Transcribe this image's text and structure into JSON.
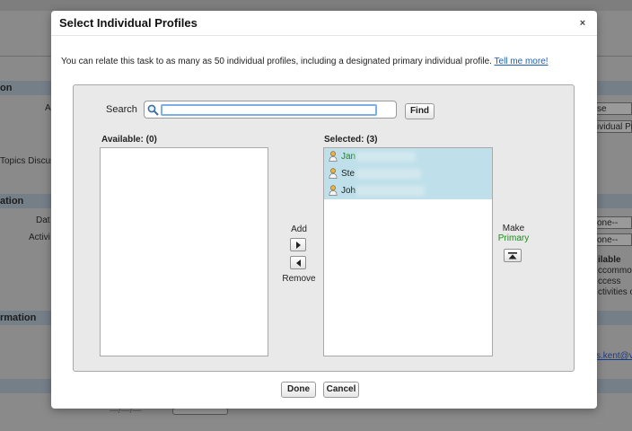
{
  "background": {
    "left_fragments": [
      "on",
      "A",
      "Topics Discus",
      "ation",
      "Dat",
      "Activi",
      "rmation"
    ],
    "right_fragments": [
      "se",
      "ividual Pr",
      "one--",
      "one--",
      "ilable",
      "ccommod",
      "ccess",
      "ctivities o",
      "s.kent@v"
    ],
    "bottom_fragment": "—/—/—"
  },
  "dialog": {
    "title": "Select Individual Profiles",
    "close_label": "×",
    "intro": "You can relate this task to as many as 50 individual profiles, including a designated primary individual profile.",
    "intro_link": "Tell me more!",
    "search_label": "Search",
    "search_value": "",
    "find_label": "Find",
    "available_label": "Available: (0)",
    "available_items": [],
    "selected_label": "Selected: (3)",
    "selected_items": [
      {
        "name": "Jan",
        "primary": true
      },
      {
        "name": "Ste",
        "primary": false
      },
      {
        "name": "Joh",
        "primary": false
      }
    ],
    "add_label": "Add",
    "remove_label": "Remove",
    "make_label": "Make",
    "primary_label": "Primary",
    "done_label": "Done",
    "cancel_label": "Cancel"
  },
  "colors": {
    "primary_text": "#1e8a1e",
    "selected_bg": "#bfe0ea",
    "link": "#1d5fb8"
  }
}
